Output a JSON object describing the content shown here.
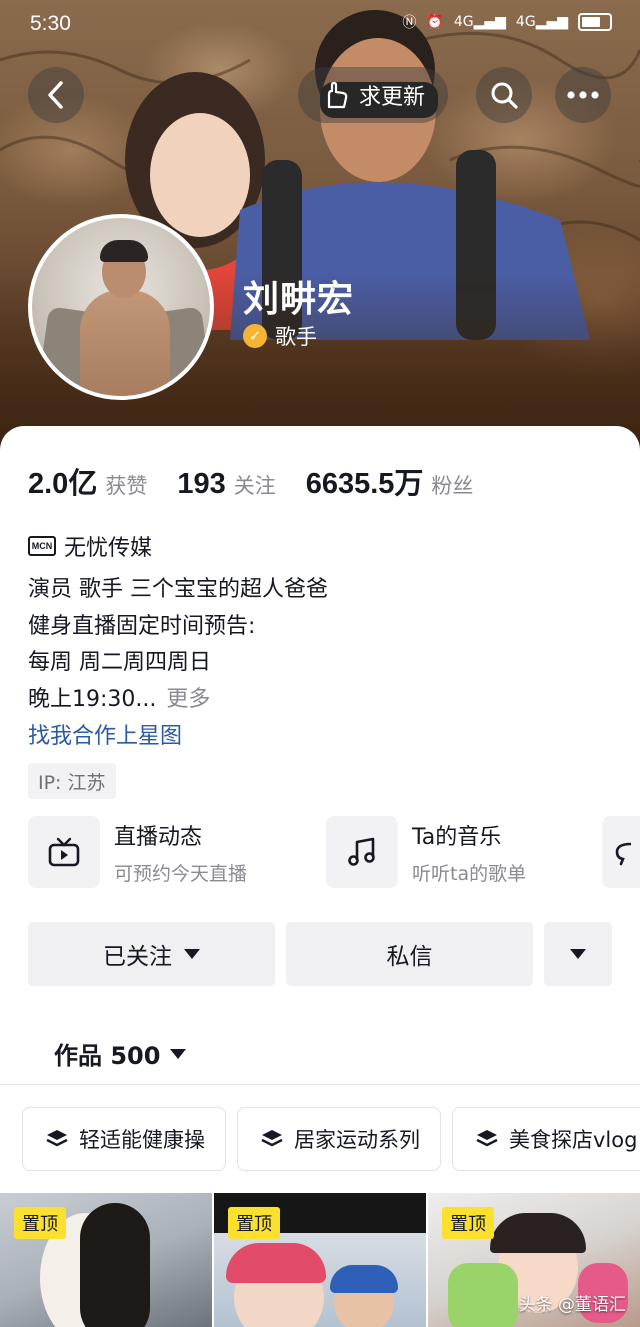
{
  "status_bar": {
    "time": "5:30",
    "net_1": "4G",
    "net_2": "4G"
  },
  "header": {
    "update_label": "求更新",
    "name": "刘畊宏",
    "verified_title": "歌手",
    "verify_color": "#f5b433"
  },
  "stats": [
    {
      "num": "2.0亿",
      "label": "获赞"
    },
    {
      "num": "193",
      "label": "关注"
    },
    {
      "num": "6635.5万",
      "label": "粉丝"
    }
  ],
  "mcn": {
    "icon_text": "MCN",
    "name": "无忧传媒"
  },
  "bio": {
    "lines": [
      "演员 歌手 三个宝宝的超人爸爸",
      "健身直播固定时间预告:",
      "每周 周二周四周日",
      "晚上19:30..."
    ],
    "more": "更多"
  },
  "star_link": "找我合作上星图",
  "ip_tag": "IP:  江苏",
  "features": [
    {
      "title": "直播动态",
      "sub": "可预约今天直播",
      "icon": "tv-icon"
    },
    {
      "title": "Ta的音乐",
      "sub": "听听ta的歌单",
      "icon": "music-note-icon"
    }
  ],
  "actions": {
    "follow": "已关注",
    "message": "私信"
  },
  "works": {
    "label": "作品 500"
  },
  "chips": [
    "轻适能健康操",
    "居家运动系列",
    "美食探店vlog"
  ],
  "tiles": [
    {
      "pin": "置顶"
    },
    {
      "pin": "置顶"
    },
    {
      "pin": "置顶",
      "watermark": "头条 @董语汇"
    }
  ],
  "colors": {
    "accent_link": "#2a5aa3",
    "pin_yellow": "#fbe02e"
  }
}
